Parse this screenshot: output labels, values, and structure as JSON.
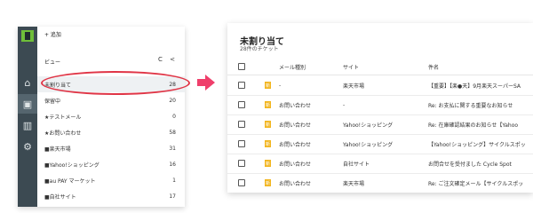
{
  "sidebar": {
    "new_label": "+ 追加",
    "view_label": "ビュー",
    "view_tools": "C <",
    "rail_icons": [
      "home-icon",
      "inbox-icon",
      "chart-icon",
      "gear-icon"
    ],
    "items": [
      {
        "label": "未割り当て",
        "count": "28"
      },
      {
        "label": "保留中",
        "count": "20"
      },
      {
        "label": "★テストメール",
        "count": "0"
      },
      {
        "label": "★お問い合わせ",
        "count": "58"
      },
      {
        "label": "■楽天市場",
        "count": "31"
      },
      {
        "label": "■Yahoo!ショッピング",
        "count": "16"
      },
      {
        "label": "■au PAY マーケット",
        "count": "1"
      },
      {
        "label": "■自社サイト",
        "count": "17"
      }
    ]
  },
  "main": {
    "title": "未割り当て",
    "subtitle": "28件のチケット",
    "columns": [
      "メール種別",
      "サイト",
      "件名"
    ],
    "rows": [
      {
        "badge": "新",
        "type": "-",
        "site": "楽天市場",
        "subject": "【重要】【楽●天】9月楽天スーパーSA"
      },
      {
        "badge": "新",
        "type": "お問い合わせ",
        "site": "-",
        "subject": "Re: お支払に関する重要なお知らせ"
      },
      {
        "badge": "新",
        "type": "お問い合わせ",
        "site": "Yahoo!ショッピング",
        "subject": "Re: 在庫確認結果のお知らせ【Yahoo"
      },
      {
        "badge": "新",
        "type": "お問い合わせ",
        "site": "Yahoo!ショッピング",
        "subject": "【Yahoo!ショッピング】サイクルスポッ"
      },
      {
        "badge": "新",
        "type": "お問い合わせ",
        "site": "自社サイト",
        "subject": "お問合せを受付ました Cycle Spot"
      },
      {
        "badge": "新",
        "type": "お問い合わせ",
        "site": "楽天市場",
        "subject": "Re: ご注文確定メール【サイクルスポッ"
      }
    ]
  },
  "colors": {
    "accent_ring": "#e03546",
    "arrow": "#ef3f6b",
    "badge": "#f2b51d",
    "rail": "#3c4a52"
  }
}
